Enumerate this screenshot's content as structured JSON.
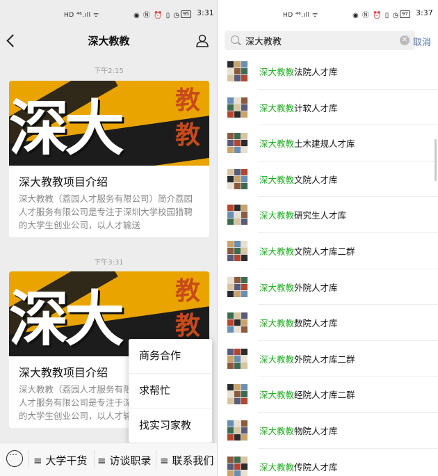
{
  "left": {
    "status": {
      "signal": "HD ⁴⁶.ıll ᯤ",
      "icons": "◉ Ⓝ ⏰ ▯ ◷",
      "battery": "95",
      "time": "3:31"
    },
    "title": "深大教教",
    "messages": [
      {
        "time": "下午2:15",
        "cover_text": "深大",
        "cover_seal": "教教",
        "title": "深大教教项目介绍",
        "desc": "深大教教（荔园人才服务有限公司）简介荔园人才服务有限公司是专注于深圳大学校园猎聘的大学生创业公司，以人才输送"
      },
      {
        "time": "下午3:31",
        "cover_text": "深大",
        "cover_seal": "教教",
        "title": "深大教教项目介绍",
        "desc": "深大教教（荔园人才服务有限公司）简介荔园人才服务有限公司是专注于深圳大学校园猎聘的大学生创业公司，以人才输送"
      }
    ],
    "popup_menu": [
      "商务合作",
      "求帮忙",
      "找实习家教"
    ],
    "bottom_menu": [
      "≡ 大学干货",
      "≡ 访谈职录",
      "≡ 联系我们"
    ]
  },
  "right": {
    "status": {
      "signal": "HD ⁴⁶.ıll ᯤ",
      "icons": "◉ Ⓝ ⏰ ▯ ◷",
      "battery": "97",
      "time": "3:37"
    },
    "search": {
      "query": "深大教教",
      "cancel": "取消"
    },
    "highlight": "深大教教",
    "results": [
      "法院人才库",
      "计软人才库",
      "土木建规人才库",
      "文院人才库",
      "研究生人才库",
      "文院人才库二群",
      "外院人才库",
      "数院人才库",
      "外院人才库二群",
      "经院人才库二群",
      "物院人才库",
      "传院人才库"
    ]
  },
  "colors": {
    "accent_green": "#1aad19",
    "link_blue": "#4a6fa8",
    "cover_orange": "#e9a400"
  }
}
